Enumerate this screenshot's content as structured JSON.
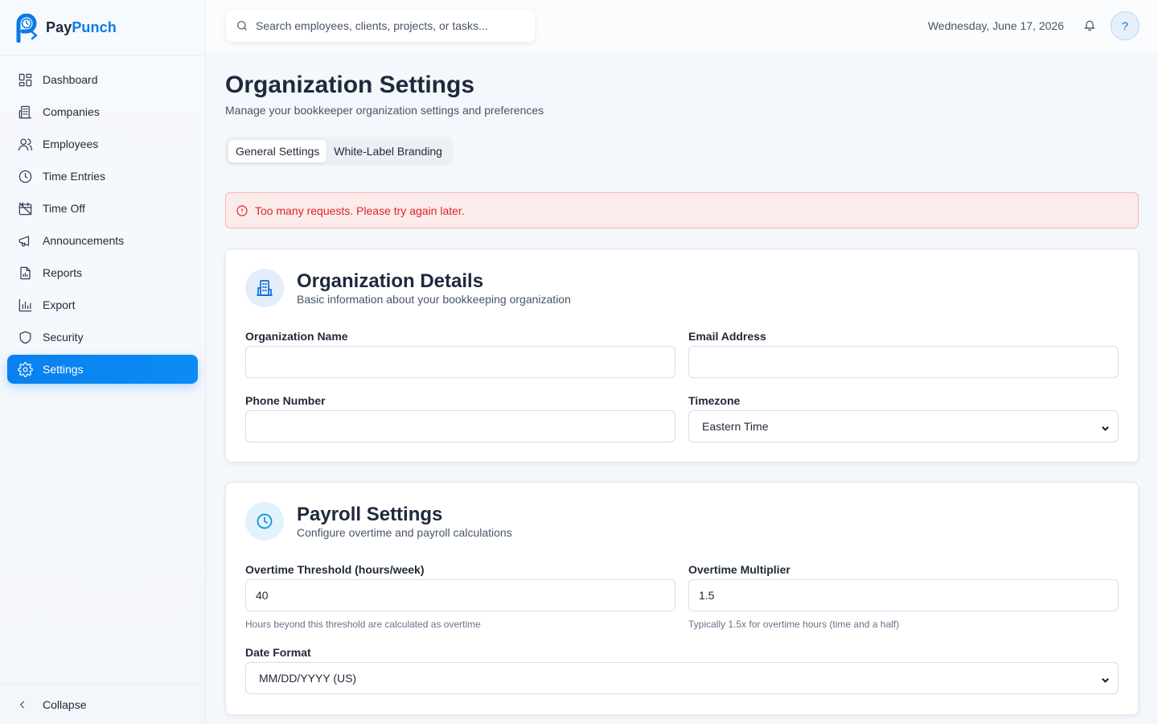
{
  "app": {
    "name_part1": "Pay",
    "name_part2": "Punch",
    "brand_color": "#0a7ae6"
  },
  "sidebar": {
    "items": [
      {
        "label": "Dashboard",
        "icon": "dashboard-icon",
        "active": false
      },
      {
        "label": "Companies",
        "icon": "building-icon",
        "active": false
      },
      {
        "label": "Employees",
        "icon": "users-icon",
        "active": false
      },
      {
        "label": "Time Entries",
        "icon": "clock-icon",
        "active": false
      },
      {
        "label": "Time Off",
        "icon": "calendar-off-icon",
        "active": false
      },
      {
        "label": "Announcements",
        "icon": "megaphone-icon",
        "active": false
      },
      {
        "label": "Reports",
        "icon": "report-icon",
        "active": false
      },
      {
        "label": "Export",
        "icon": "bar-chart-icon",
        "active": false
      },
      {
        "label": "Security",
        "icon": "shield-icon",
        "active": false
      },
      {
        "label": "Settings",
        "icon": "gear-icon",
        "active": true
      }
    ],
    "collapse_label": "Collapse"
  },
  "topbar": {
    "search_placeholder": "Search employees, clients, projects, or tasks...",
    "date": "Wednesday, June 17, 2026",
    "help_label": "?"
  },
  "page": {
    "title": "Organization Settings",
    "subtitle": "Manage your bookkeeper organization settings and preferences",
    "tabs": [
      {
        "label": "General Settings",
        "active": true
      },
      {
        "label": "White-Label Branding",
        "active": false
      }
    ],
    "alert": "Too many requests. Please try again later."
  },
  "org_details": {
    "title": "Organization Details",
    "subtitle": "Basic information about your bookkeeping organization",
    "org_name_label": "Organization Name",
    "org_name_value": "",
    "email_label": "Email Address",
    "email_value": "",
    "phone_label": "Phone Number",
    "phone_value": "",
    "timezone_label": "Timezone",
    "timezone_value": "Eastern Time"
  },
  "payroll": {
    "title": "Payroll Settings",
    "subtitle": "Configure overtime and payroll calculations",
    "threshold_label": "Overtime Threshold (hours/week)",
    "threshold_value": "40",
    "threshold_help": "Hours beyond this threshold are calculated as overtime",
    "multiplier_label": "Overtime Multiplier",
    "multiplier_value": "1.5",
    "multiplier_help": "Typically 1.5x for overtime hours (time and a half)",
    "date_format_label": "Date Format",
    "date_format_value": "MM/DD/YYYY (US)"
  }
}
